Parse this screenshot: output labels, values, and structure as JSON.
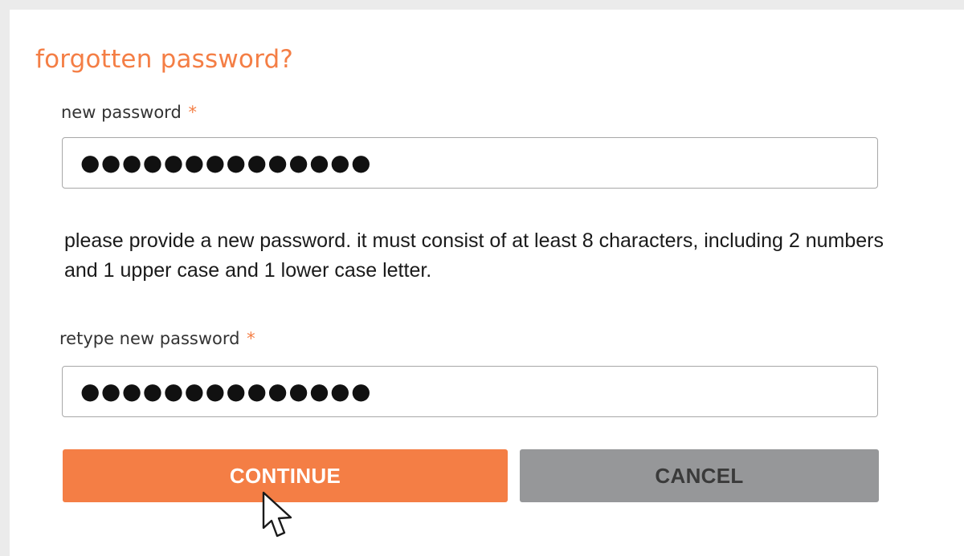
{
  "form": {
    "title": "forgotten password?",
    "new_password": {
      "label": "new password",
      "required_marker": "*",
      "value_masked": "●●●●●●●●●●●●●●"
    },
    "hint": "please provide a new password. it must consist of at least 8 characters, including 2 numbers and 1 upper case and 1 lower case letter.",
    "retype_password": {
      "label": "retype new password",
      "required_marker": "*",
      "value_masked": "●●●●●●●●●●●●●●"
    },
    "buttons": {
      "continue_label": "CONTINUE",
      "cancel_label": "CANCEL"
    }
  },
  "colors": {
    "accent": "#f47e45",
    "cancel": "#969799",
    "background": "#ebebeb"
  },
  "cursor": {
    "icon": "arrow-cursor-icon"
  }
}
